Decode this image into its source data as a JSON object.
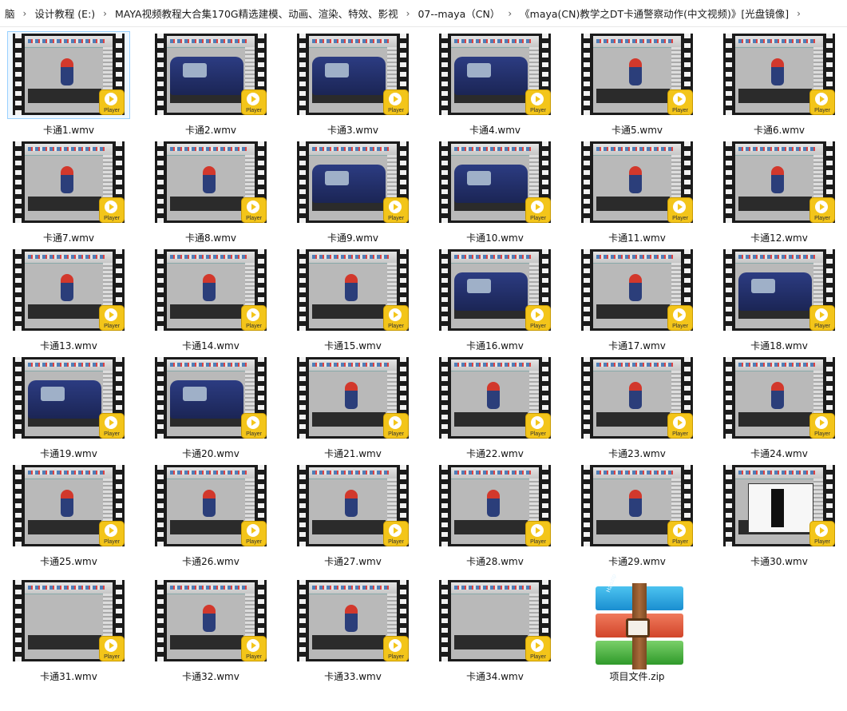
{
  "breadcrumb": [
    "脑",
    "设计教程 (E:)",
    "MAYA视频教程大合集170G精选建模、动画、渲染、特效、影视",
    "07--maya（CN）",
    "《maya(CN)教学之DT卡通警察动作(中文视频)》[光盘镜像]"
  ],
  "badge_text": "Player",
  "zip_brand": "Haozip",
  "files": [
    {
      "name": "卡通1.wmv",
      "scene": "char"
    },
    {
      "name": "卡通2.wmv",
      "scene": "car"
    },
    {
      "name": "卡通3.wmv",
      "scene": "car"
    },
    {
      "name": "卡通4.wmv",
      "scene": "car"
    },
    {
      "name": "卡通5.wmv",
      "scene": "char"
    },
    {
      "name": "卡通6.wmv",
      "scene": "char"
    },
    {
      "name": "卡通7.wmv",
      "scene": "char"
    },
    {
      "name": "卡通8.wmv",
      "scene": "char"
    },
    {
      "name": "卡通9.wmv",
      "scene": "car"
    },
    {
      "name": "卡通10.wmv",
      "scene": "car"
    },
    {
      "name": "卡通11.wmv",
      "scene": "char"
    },
    {
      "name": "卡通12.wmv",
      "scene": "char"
    },
    {
      "name": "卡通13.wmv",
      "scene": "char"
    },
    {
      "name": "卡通14.wmv",
      "scene": "char"
    },
    {
      "name": "卡通15.wmv",
      "scene": "char"
    },
    {
      "name": "卡通16.wmv",
      "scene": "car"
    },
    {
      "name": "卡通17.wmv",
      "scene": "char"
    },
    {
      "name": "卡通18.wmv",
      "scene": "car"
    },
    {
      "name": "卡通19.wmv",
      "scene": "car"
    },
    {
      "name": "卡通20.wmv",
      "scene": "car"
    },
    {
      "name": "卡通21.wmv",
      "scene": "char"
    },
    {
      "name": "卡通22.wmv",
      "scene": "char"
    },
    {
      "name": "卡通23.wmv",
      "scene": "char"
    },
    {
      "name": "卡通24.wmv",
      "scene": "char"
    },
    {
      "name": "卡通25.wmv",
      "scene": "char"
    },
    {
      "name": "卡通26.wmv",
      "scene": "char"
    },
    {
      "name": "卡通27.wmv",
      "scene": "char"
    },
    {
      "name": "卡通28.wmv",
      "scene": "char"
    },
    {
      "name": "卡通29.wmv",
      "scene": "char"
    },
    {
      "name": "卡通30.wmv",
      "scene": "window"
    },
    {
      "name": "卡通31.wmv",
      "scene": "empty"
    },
    {
      "name": "卡通32.wmv",
      "scene": "char"
    },
    {
      "name": "卡通33.wmv",
      "scene": "char"
    },
    {
      "name": "卡通34.wmv",
      "scene": "empty"
    },
    {
      "name": "项目文件.zip",
      "scene": "zip"
    }
  ],
  "selected_index": 0
}
